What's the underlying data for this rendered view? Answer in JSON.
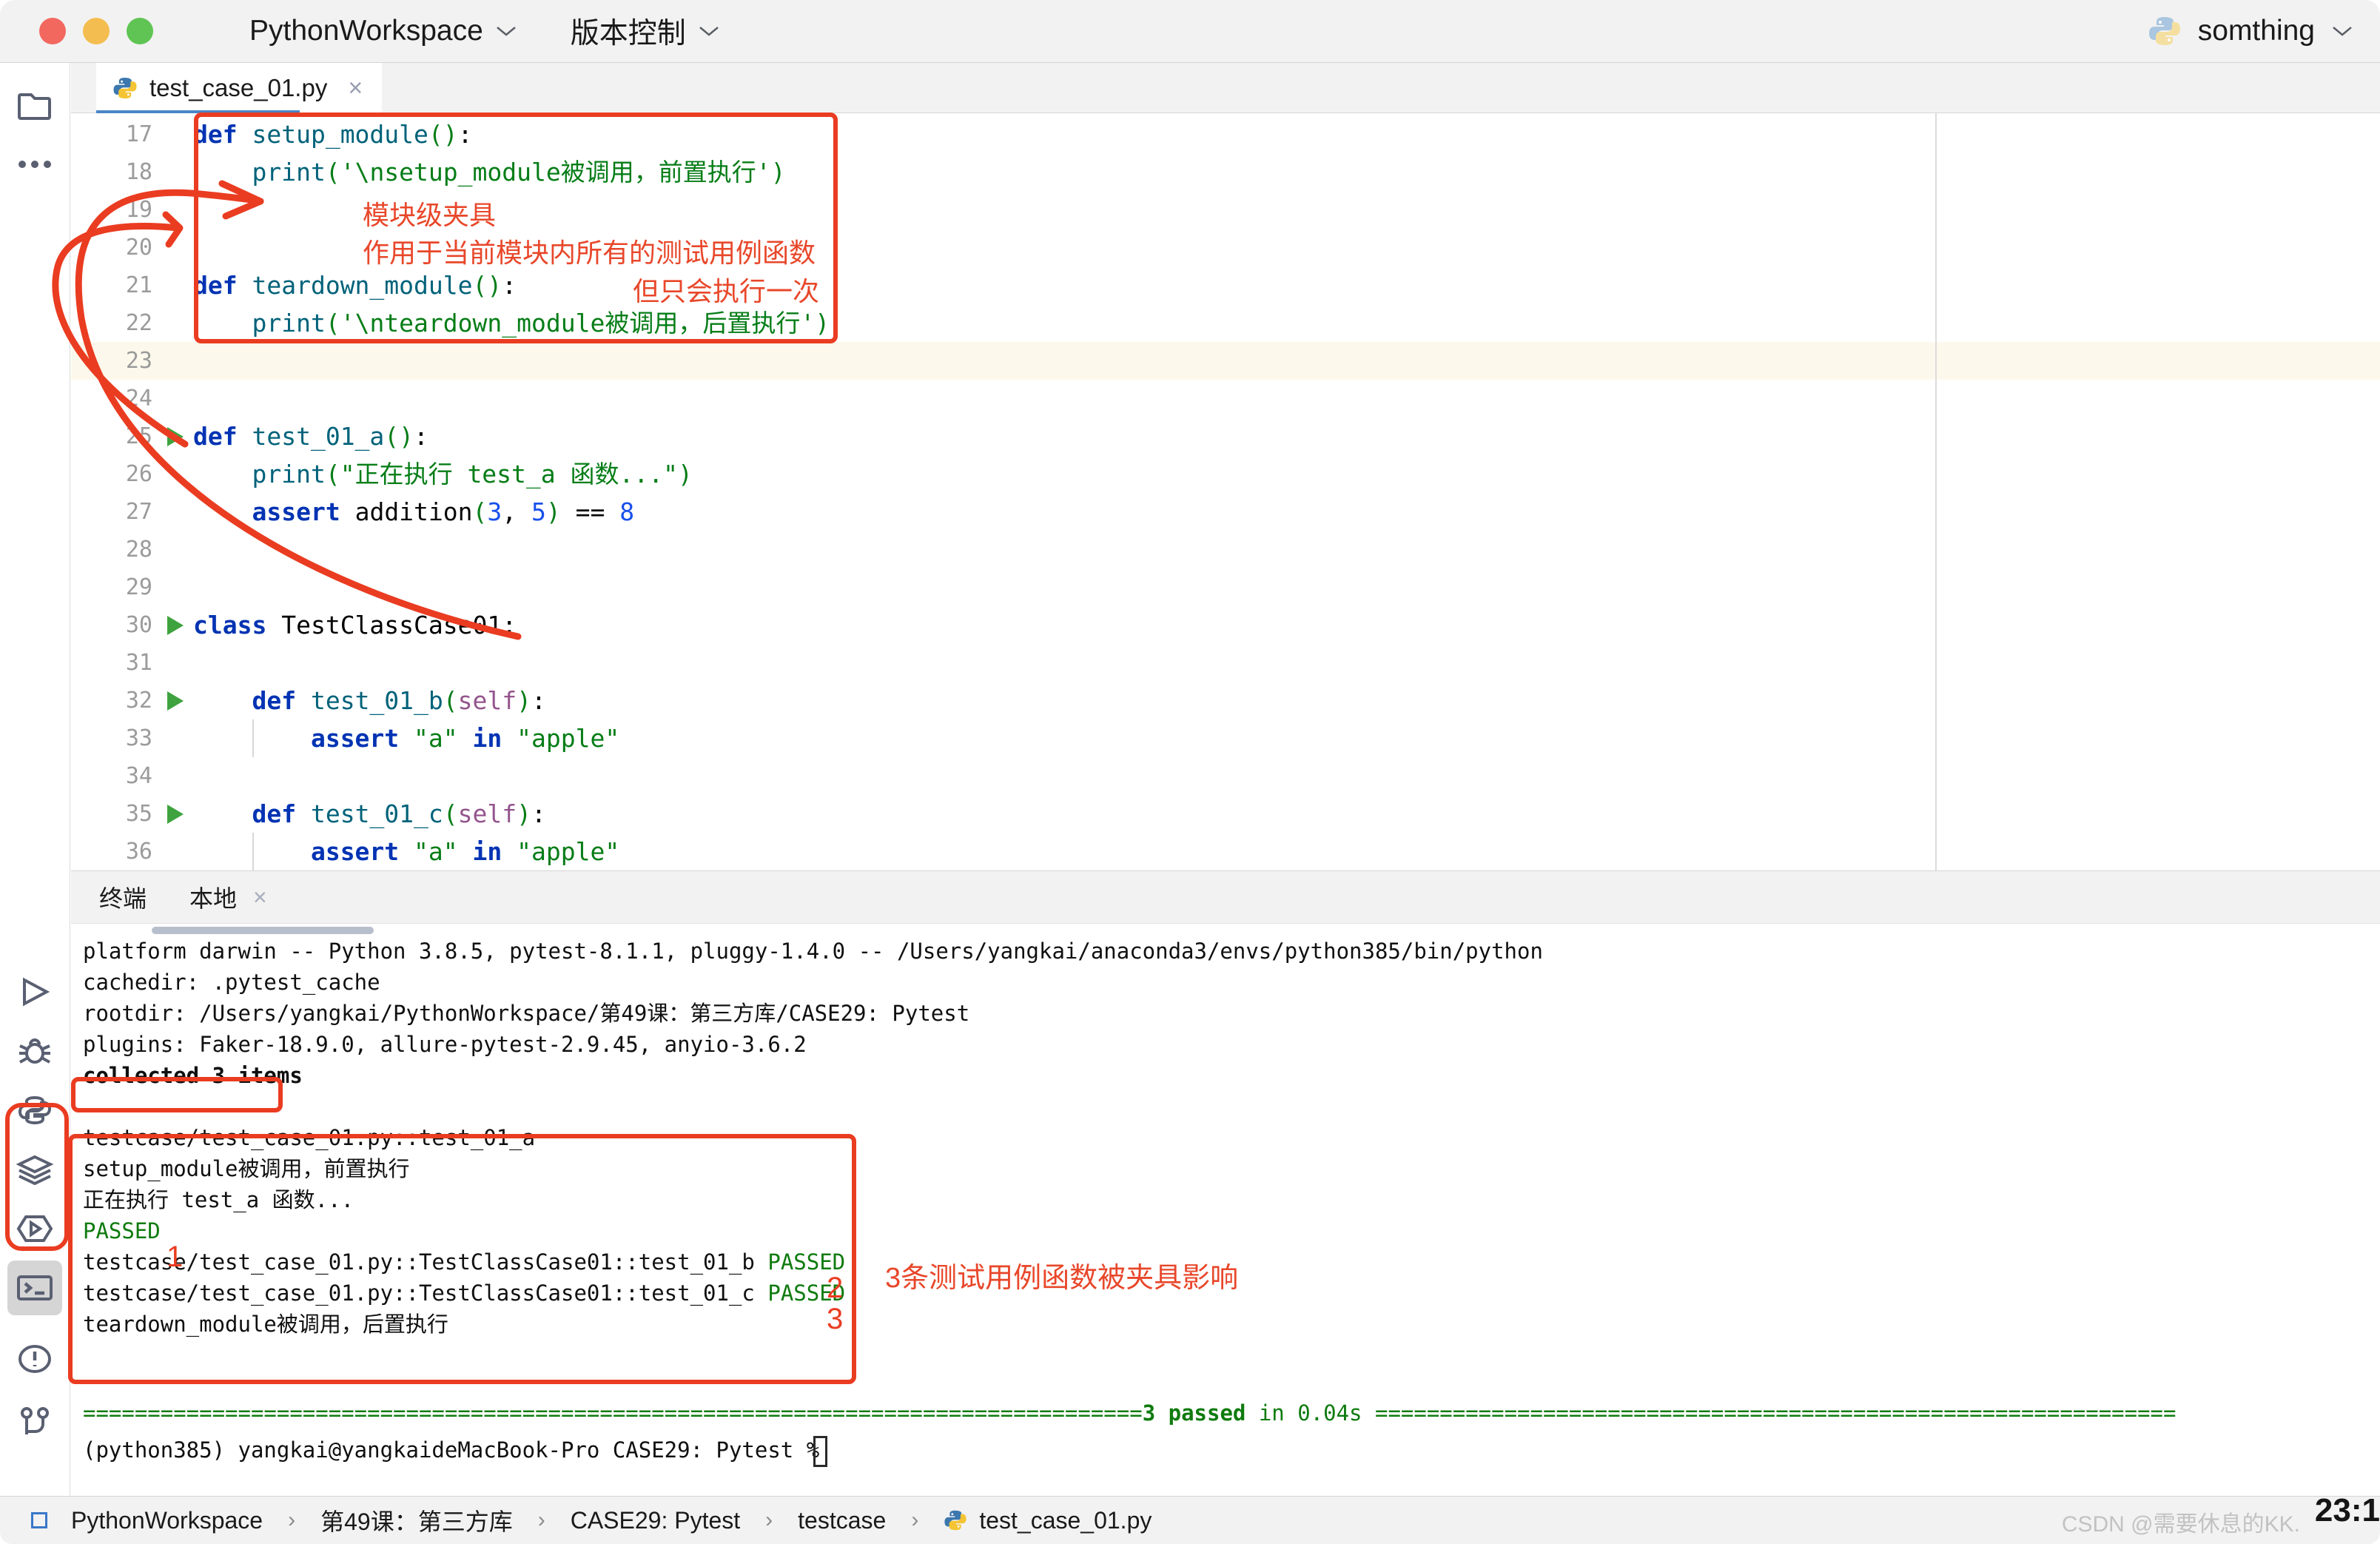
{
  "titlebar": {
    "project": "PythonWorkspace",
    "vcs": "版本控制",
    "account": "somthing",
    "chevron": "⌄"
  },
  "tab": {
    "filename": "test_case_01.py",
    "close": "×"
  },
  "editor": {
    "lines": [
      {
        "no": "17",
        "run": false,
        "indent": 0,
        "html": "<span class='k'>def</span> <span class='fn'>setup_module</span><span class='s'>(</span><span class='s'>)</span><span class='p'>:</span>"
      },
      {
        "no": "18",
        "run": false,
        "indent": 0,
        "html": "    <span class='fn'>print</span><span class='s'>(</span><span class='s'>'\\nsetup_module被调用，前置执行'</span><span class='s'>)</span>"
      },
      {
        "no": "19",
        "run": false,
        "indent": 0,
        "html": ""
      },
      {
        "no": "20",
        "run": false,
        "indent": 0,
        "html": ""
      },
      {
        "no": "21",
        "run": false,
        "indent": 0,
        "html": "<span class='k'>def</span> <span class='fn'>teardown_module</span><span class='s'>(</span><span class='s'>)</span><span class='p'>:</span>"
      },
      {
        "no": "22",
        "run": false,
        "indent": 0,
        "html": "    <span class='fn'>print</span><span class='s'>(</span><span class='s'>'\\nteardown_module被调用，后置执行'</span><span class='s'>)</span>"
      },
      {
        "no": "23",
        "run": false,
        "indent": 0,
        "html": ""
      },
      {
        "no": "24",
        "run": false,
        "indent": 0,
        "html": ""
      },
      {
        "no": "25",
        "run": true,
        "indent": 0,
        "html": "<span class='k'>def</span> <span class='fn'>test_01_a</span><span class='s'>(</span><span class='s'>)</span><span class='p'>:</span>"
      },
      {
        "no": "26",
        "run": false,
        "indent": 0,
        "html": "    <span class='fn'>print</span><span class='s'>(</span><span class='s'>\"正在执行 test_a 函数...\"</span><span class='s'>)</span>"
      },
      {
        "no": "27",
        "run": false,
        "indent": 0,
        "html": "    <span class='k'>assert</span> <span class='p'>addition</span><span class='s'>(</span><span class='n'>3</span><span class='p'>, </span><span class='n'>5</span><span class='s'>)</span> <span class='p'>==</span> <span class='n'>8</span>"
      },
      {
        "no": "28",
        "run": false,
        "indent": 0,
        "html": ""
      },
      {
        "no": "29",
        "run": false,
        "indent": 0,
        "html": ""
      },
      {
        "no": "30",
        "run": true,
        "indent": 0,
        "html": "<span class='k'>class</span> <span class='cls'>TestClassCase01</span><span class='p'>:</span>"
      },
      {
        "no": "31",
        "run": false,
        "indent": 0,
        "html": ""
      },
      {
        "no": "32",
        "run": true,
        "indent": 0,
        "html": "    <span class='k'>def</span> <span class='fn'>test_01_b</span><span class='s'>(</span><span class='self'>self</span><span class='s'>)</span><span class='p'>:</span>"
      },
      {
        "no": "33",
        "run": false,
        "indent": 0,
        "html": "        <span class='k'>assert</span> <span class='s'>\"a\"</span> <span class='k'>in</span> <span class='s'>\"apple\"</span>"
      },
      {
        "no": "34",
        "run": false,
        "indent": 0,
        "html": ""
      },
      {
        "no": "35",
        "run": true,
        "indent": 0,
        "html": "    <span class='k'>def</span> <span class='fn'>test_01_c</span><span class='s'>(</span><span class='self'>self</span><span class='s'>)</span><span class='p'>:</span>"
      },
      {
        "no": "36",
        "run": false,
        "indent": 0,
        "html": "        <span class='k'>assert</span> <span class='s'>\"a\"</span> <span class='k'>in</span> <span class='s'>\"apple\"</span>"
      }
    ],
    "current_line": "23"
  },
  "annotations": {
    "editor_note_1": "模块级夹具",
    "editor_note_2": "作用于当前模块内所有的测试用例函数",
    "editor_note_3": "但只会执行一次",
    "terminal_note": "3条测试用例函数被夹具影响",
    "marker_1": "1",
    "marker_2": "2",
    "marker_3": "3"
  },
  "terminal_panel": {
    "tab_terminal": "终端",
    "tab_local": "本地",
    "close": "×"
  },
  "terminal": {
    "lines": [
      {
        "html": "platform darwin -- Python 3.8.5, pytest-8.1.1, pluggy-1.4.0 -- /Users/yangkai/anaconda3/envs/python385/bin/python"
      },
      {
        "html": "cachedir: .pytest_cache"
      },
      {
        "html": "rootdir: /Users/yangkai/PythonWorkspace/第49课：第三方库/CASE29: Pytest"
      },
      {
        "html": "plugins: Faker-18.9.0, allure-pytest-2.9.45, anyio-3.6.2"
      },
      {
        "html": "<span class='tbold'>collected 3 items</span>"
      },
      {
        "html": ""
      },
      {
        "html": "testcase/test_case_01.py::test_01_a"
      },
      {
        "html": "setup_module被调用，前置执行"
      },
      {
        "html": "正在执行 test_a 函数..."
      },
      {
        "html": "<span class='tg'>PASSED</span>"
      },
      {
        "html": "testcase/test_case_01.py::TestClassCase01::test_01_b <span class='tg'>PASSED</span>"
      },
      {
        "html": "testcase/test_case_01.py::TestClassCase01::test_01_c <span class='tg'>PASSED</span>"
      },
      {
        "html": "teardown_module被调用，后置执行"
      },
      {
        "html": ""
      },
      {
        "html": ""
      }
    ],
    "summary_left": "==================================================================================",
    "summary_center": "3 passed",
    "summary_mid": " in 0.04s ",
    "summary_right": "==============================================================",
    "prompt": "(python385) yangkai@yangkaideMacBook-Pro CASE29: Pytest % "
  },
  "statusbar": {
    "crumbs": [
      "PythonWorkspace",
      "第49课：第三方库",
      "CASE29: Pytest",
      "testcase",
      "test_case_01.py"
    ],
    "separator": "›",
    "watermark": "CSDN @需要休息的KK.",
    "clock": "23:1"
  },
  "colors": {
    "accent_red": "#ea3c21",
    "pass_green": "#0f7b0f",
    "keyword_blue": "#0033b3",
    "string_green": "#067d17",
    "tab_underline": "#4a86c8"
  }
}
